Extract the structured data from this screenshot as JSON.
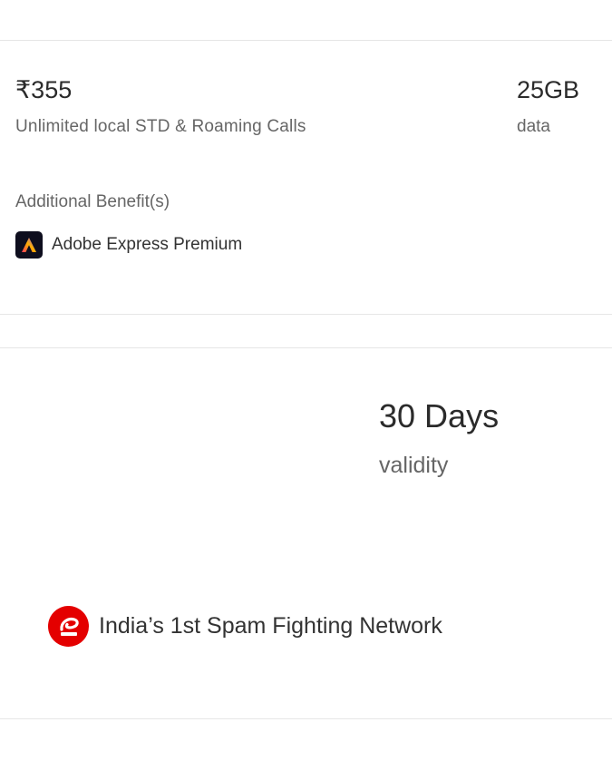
{
  "plan": {
    "price": "₹355",
    "calls": "Unlimited local STD & Roaming Calls",
    "data_value": "25GB",
    "data_label": "data",
    "additional_title": "Additional Benefit(s)",
    "benefits": [
      {
        "name": "Adobe Express Premium",
        "icon": "adobe-express-icon"
      }
    ]
  },
  "validity": {
    "value": "30 Days",
    "label": "validity"
  },
  "network": {
    "tagline": "India’s 1st Spam Fighting Network",
    "icon": "airtel-logo",
    "brand_color": "#e40000"
  }
}
